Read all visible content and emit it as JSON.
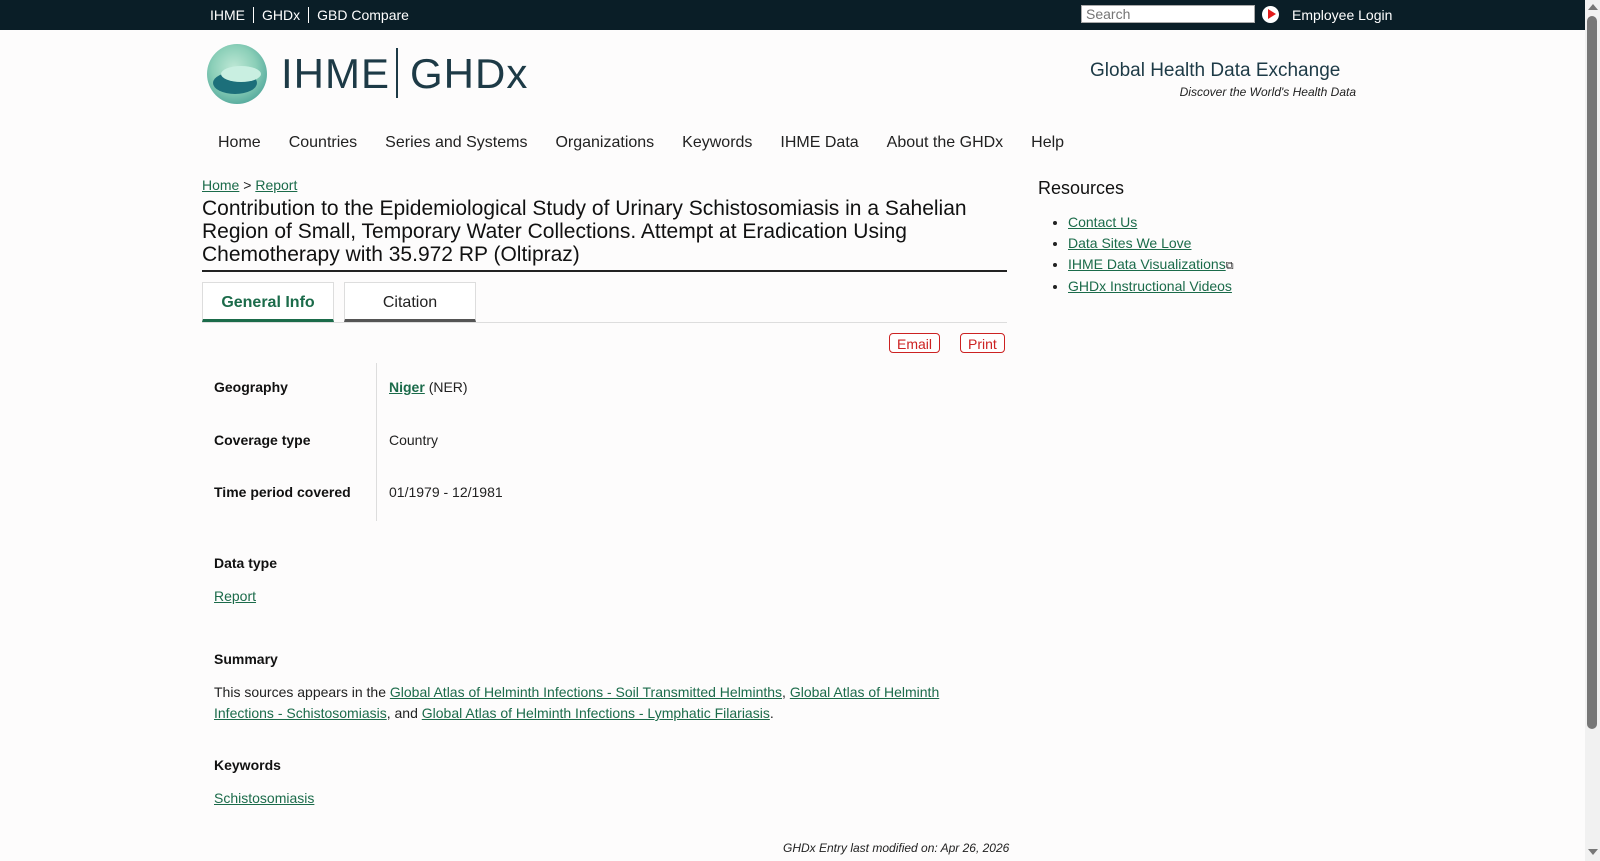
{
  "topbar": {
    "links": [
      "IHME",
      "GHDx",
      "GBD Compare"
    ],
    "search_placeholder": "Search",
    "employee_login": "Employee Login"
  },
  "header": {
    "brand_left": "IHME",
    "brand_right": "GHDx",
    "tagline": "Global Health Data Exchange",
    "tagline_sub": "Discover the World's Health Data"
  },
  "nav": [
    "Home",
    "Countries",
    "Series and Systems",
    "Organizations",
    "Keywords",
    "IHME Data",
    "About the GHDx",
    "Help"
  ],
  "breadcrumb": {
    "home": "Home",
    "sep": ">",
    "current": "Report"
  },
  "title": "Contribution to the Epidemiological Study of Urinary Schistosomiasis in a Sahelian Region of Small, Temporary Water Collections. Attempt at Eradication Using Chemotherapy with 35.972 RP (Oltipraz)",
  "tabs": [
    "General Info",
    "Citation"
  ],
  "actions": {
    "email": "Email",
    "print": "Print"
  },
  "fields": {
    "geography_label": "Geography",
    "geography_link": "Niger",
    "geography_code": "(NER)",
    "coverage_label": "Coverage type",
    "coverage_value": "Country",
    "time_label": "Time period covered",
    "time_value": "01/1979 - 12/1981"
  },
  "data_type": {
    "label": "Data type",
    "value": "Report"
  },
  "summary": {
    "label": "Summary",
    "intro": "This sources appears in the ",
    "link1": "Global Atlas of Helminth Infections - Soil Transmitted Helminths",
    "sep1": ", ",
    "link2": "Global Atlas of Helminth Infections - Schistosomiasis",
    "sep2": ", and ",
    "link3": "Global Atlas of Helminth Infections - Lymphatic Filariasis",
    "end": "."
  },
  "keywords": {
    "label": "Keywords",
    "value": "Schistosomiasis"
  },
  "modified": "GHDx Entry last modified on: Apr 26, 2026",
  "resources": {
    "title": "Resources",
    "items": [
      "Contact Us",
      "Data Sites We Love",
      "IHME Data Visualizations",
      "GHDx Instructional Videos"
    ],
    "external_icon": "⧉"
  }
}
